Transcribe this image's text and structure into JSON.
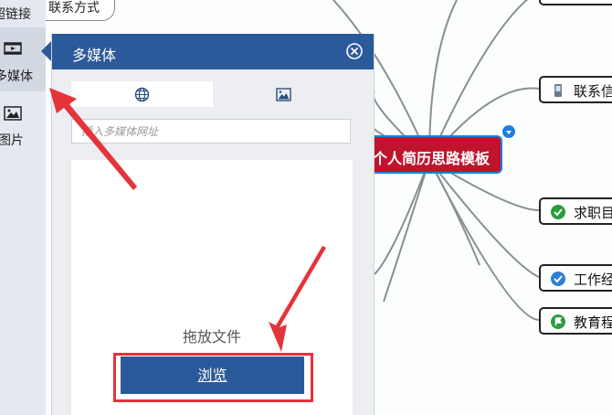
{
  "sidebar": {
    "items": [
      {
        "label": "超链接",
        "icon": "hyperlink-icon"
      },
      {
        "label": "多媒体",
        "icon": "film-icon"
      },
      {
        "label": "图片",
        "icon": "picture-icon"
      }
    ]
  },
  "panel": {
    "title": "多媒体",
    "tabs": [
      {
        "icon": "globe-icon"
      },
      {
        "icon": "image-icon"
      }
    ],
    "url_placeholder": "插入多媒体网址",
    "drop_label": "拖放文件",
    "browse_label": "浏览"
  },
  "mindmap": {
    "central_topic": "个人简历思路模板",
    "top_partial_topic": "联系方式",
    "topics": [
      {
        "label": "联系信",
        "icon": "phone-icon"
      },
      {
        "label": "求职目",
        "icon": "check-green-icon"
      },
      {
        "label": "工作经",
        "icon": "check-blue-icon"
      },
      {
        "label": "教育程",
        "icon": "flag-green-icon"
      }
    ]
  },
  "colors": {
    "panel_header": "#2b5a9a",
    "central_topic": "#c0142e",
    "annotation_red": "#e5333a",
    "sidebar": "#e4e9f1"
  }
}
